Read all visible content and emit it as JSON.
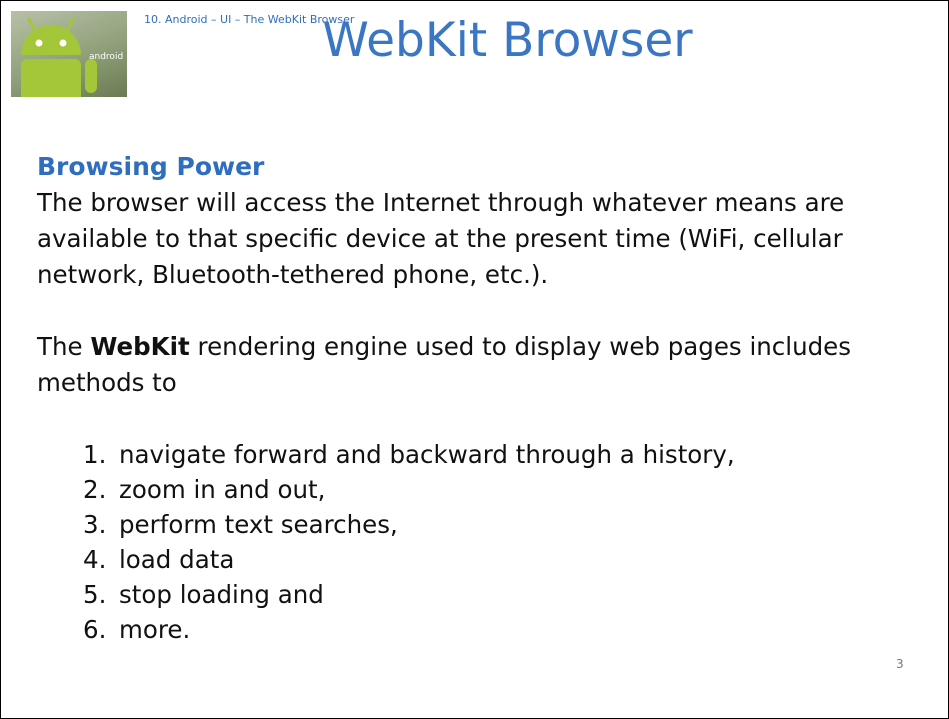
{
  "header": {
    "note": "10. Android – UI – The WebKit Browser",
    "title": "WebKit Browser",
    "logo_text": "android"
  },
  "section": {
    "heading": "Browsing Power",
    "paragraph1": "The browser will access the Internet through whatever means are available to that specific device at the present time (WiFi, cellular network, Bluetooth-tethered phone, etc.).",
    "paragraph2_prefix": "The ",
    "paragraph2_bold": "WebKit",
    "paragraph2_suffix": " rendering engine used to display web pages includes methods to"
  },
  "methods": [
    {
      "num": "1.",
      "text": "navigate forward and backward through a history,"
    },
    {
      "num": "2.",
      "text": "zoom in and out,"
    },
    {
      "num": "3.",
      "text": "perform text searches,"
    },
    {
      "num": "4.",
      "text": "load data"
    },
    {
      "num": "5.",
      "text": "stop loading and"
    },
    {
      "num": "6.",
      "text": "more."
    }
  ],
  "footer": {
    "page_number": "3"
  },
  "colors": {
    "title": "#3b76c3",
    "heading": "#2f6dbf",
    "android_green": "#a4c639"
  },
  "icons": {
    "logo": "android-robot-icon"
  }
}
